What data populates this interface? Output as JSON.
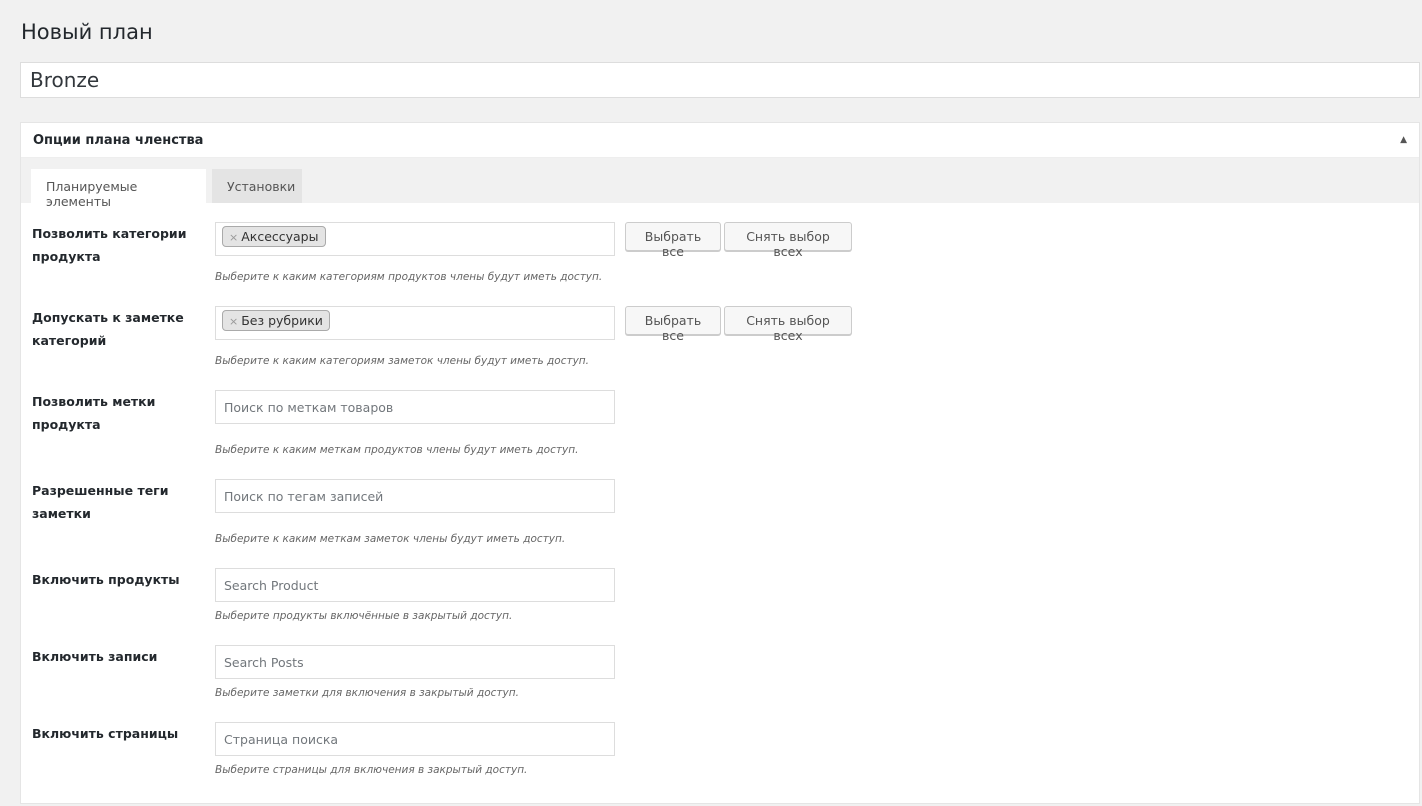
{
  "page": {
    "title": "Новый план",
    "plan_name": "Bronze"
  },
  "panel": {
    "title": "Опции плана членства",
    "tabs": [
      {
        "label": "Планируемые элементы",
        "active": true
      },
      {
        "label": "Установки",
        "active": false
      }
    ]
  },
  "buttons": {
    "select_all": "Выбрать все",
    "deselect_all": "Снять выбор всех"
  },
  "rows": [
    {
      "label": "Позволить категории продукта",
      "chip": "Аксессуары",
      "desc": "Выберите к каким категориям продуктов члены будут иметь доступ."
    },
    {
      "label": "Допускать к заметке категорий",
      "chip": "Без рубрики",
      "desc": "Выберите к каким категориям заметок члены будут иметь доступ."
    },
    {
      "label": "Позволить метки продукта",
      "placeholder": "Поиск по меткам товаров",
      "desc": "Выберите к каким меткам продуктов члены будут иметь доступ."
    },
    {
      "label": "Разрешенные теги заметки",
      "placeholder": "Поиск по тегам записей",
      "desc": "Выберите к каким меткам заметок члены будут иметь доступ."
    },
    {
      "label": "Включить продукты",
      "placeholder": "Search Product",
      "desc": "Выберите продукты включённые в закрытый доступ."
    },
    {
      "label": "Включить записи",
      "placeholder": "Search Posts",
      "desc": "Выберите заметки для включения в закрытый доступ."
    },
    {
      "label": "Включить страницы",
      "placeholder": "Страница поиска",
      "desc": "Выберите страницы для включения в закрытый доступ."
    }
  ]
}
